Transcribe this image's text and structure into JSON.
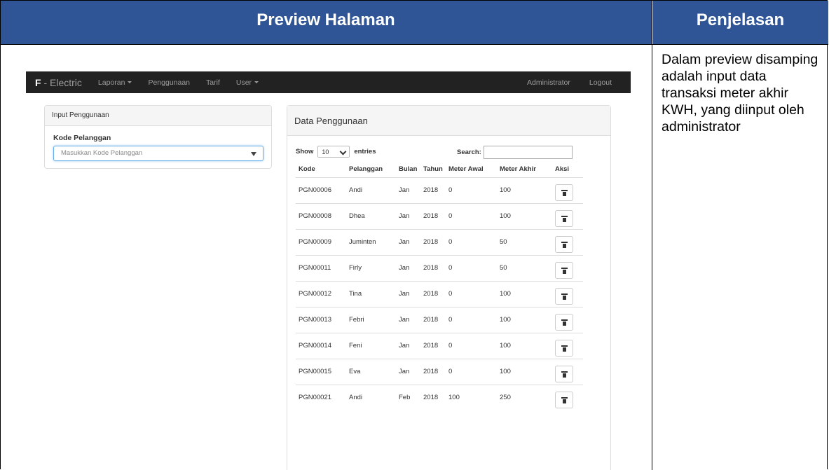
{
  "doc": {
    "col_preview": "Preview Halaman",
    "col_explain": "Penjelasan",
    "explanation": "Dalam preview disamping adalah input data transaksi meter akhir KWH, yang diinput oleh administrator"
  },
  "app": {
    "brand_bold": "F",
    "brand_rest": " - Electric",
    "nav": [
      "Laporan",
      "Penggunaan",
      "Tarif",
      "User"
    ],
    "nav_right": [
      "Administrator",
      "Logout"
    ],
    "input_panel": {
      "title": "Input Penggunaan",
      "field_label": "Kode Pelanggan",
      "field_placeholder": "Masukkan Kode Pelanggan"
    },
    "data_panel": {
      "title": "Data Penggunaan",
      "show_label": "Show",
      "entries_value": "10",
      "entries_label": "entries",
      "search_label": "Search:",
      "columns": [
        "Kode",
        "Pelanggan",
        "Bulan",
        "Tahun",
        "Meter Awal",
        "Meter Akhir",
        "Aksi"
      ],
      "rows": [
        [
          "PGN00006",
          "Andi",
          "Jan",
          "2018",
          "0",
          "100"
        ],
        [
          "PGN00008",
          "Dhea",
          "Jan",
          "2018",
          "0",
          "100"
        ],
        [
          "PGN00009",
          "Juminten",
          "Jan",
          "2018",
          "0",
          "50"
        ],
        [
          "PGN00011",
          "Firly",
          "Jan",
          "2018",
          "0",
          "50"
        ],
        [
          "PGN00012",
          "Tina",
          "Jan",
          "2018",
          "0",
          "100"
        ],
        [
          "PGN00013",
          "Febri",
          "Jan",
          "2018",
          "0",
          "100"
        ],
        [
          "PGN00014",
          "Feni",
          "Jan",
          "2018",
          "0",
          "100"
        ],
        [
          "PGN00015",
          "Eva",
          "Jan",
          "2018",
          "0",
          "100"
        ],
        [
          "PGN00021",
          "Andi",
          "Feb",
          "2018",
          "100",
          "250"
        ]
      ]
    }
  },
  "colors": {
    "header_blue": "#2f5597",
    "navbar": "#222222"
  }
}
